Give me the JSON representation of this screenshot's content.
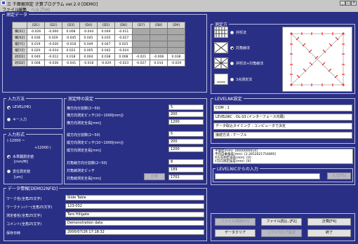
{
  "window": {
    "title": "三 千面据测定 计算ブログラム ver.2.0 [DEMO]"
  },
  "menu": [
    "ファイル",
    "编集",
    "ヘルプ(H)"
  ],
  "measure_data": {
    "title": "测定データ",
    "columns": [
      "[D1]",
      "[D2]",
      "[D3]",
      "[D4]",
      "[D5]",
      "[D6]",
      "[D7]",
      "[D8]",
      "[D9]"
    ],
    "rows": [
      {
        "label": "横[X1]",
        "values": [
          "-0.026",
          "-0.000",
          "0.008",
          "-0.044",
          "0.049",
          "-0.011",
          "",
          "",
          ""
        ]
      },
      {
        "label": "横[X2]",
        "values": [
          "0.036",
          "0.029",
          "-0.045",
          "0.045",
          "0.035",
          "-0.027",
          "",
          "",
          ""
        ]
      },
      {
        "label": "縦[Y1]",
        "values": [
          "0.019",
          "-0.030",
          "-0.018",
          "0.049",
          "0.047",
          "0.025",
          "",
          "",
          ""
        ]
      },
      {
        "label": "縦[Y2]",
        "values": [
          "0.020",
          "-0.034",
          "0.022",
          "0.005",
          "0.042",
          "-0.024",
          "",
          "",
          ""
        ]
      },
      {
        "label": "対[D1]",
        "values": [
          "0.040",
          "-0.012",
          "0.018",
          "0.004",
          "0.038",
          "0.008",
          "-0.021",
          "-0.008",
          "0.038"
        ]
      },
      {
        "label": "対[D2]",
        "values": [
          "0.008",
          "-0.036",
          "-0.041",
          "-0.018",
          "-0.029",
          "-0.023",
          "-0.027",
          "0.014",
          "-0.029"
        ]
      }
    ]
  },
  "input_method": {
    "title": "入力方法",
    "options": [
      "LEVEL(HK)",
      "キー入力"
    ]
  },
  "input_format": {
    "title": "入力形式",
    "range_low": "(-12000 ~",
    "range_high": "+12000 )",
    "options": [
      "水準器測定値",
      "変位測定値"
    ],
    "unit1": "[mm/M]",
    "unit2": "[um]"
  },
  "settings": {
    "title": "测定時の設定",
    "fields": [
      {
        "label": "横方向分割数(2~50)",
        "value": "5"
      },
      {
        "label": "横方向测定ピッチ(10~1000[mm])",
        "value": "200"
      },
      {
        "label": "横方向测定全長[mm]",
        "value": "1200"
      },
      {
        "label": "縦方向分割数(2~50)",
        "value": "5"
      },
      {
        "label": "縦方向测定ピッチ(10~1000[mm])",
        "value": "200"
      },
      {
        "label": "縦方向测定全長[mm]",
        "value": "1200"
      },
      {
        "label": "対角線方向分割数(2~50)",
        "value": "8"
      },
      {
        "label": "対角線测定ピッチ",
        "value": "189"
      },
      {
        "label": "対角線测定全長[mm]",
        "value": "1701"
      }
    ],
    "calc_button": "計算"
  },
  "pattern": {
    "title": "测定方",
    "options": [
      "井桁法",
      "対角線法",
      "井桁法+対角線法",
      "3点测定法"
    ]
  },
  "level_settings": {
    "title": "LEVELNK設定",
    "lines": [
      "COM : 1",
      "LEVELNIC : DL-S3 (インターフェース内蔵)",
      "データ取込タイミング : コンピュータで決定",
      "接続方法 : ケーブル"
    ]
  },
  "result": {
    "lines": [
      {
        "k": "平面度(mm)",
        "v": "[0000000014]"
      },
      {
        "k": "平均自乗偏差(mm)",
        "v": "[2.2652621754895]"
      },
      {
        "k": "X方向測定誤差(mm)",
        "v": "[0]"
      },
      {
        "k": "Y方向测定誤差(mm)",
        "v": "[0]"
      }
    ],
    "level_input_title": "LEVELNICからの入力",
    "input_button": "入力[F5]"
  },
  "data_info": {
    "title": "データ情報[DEMO2NFID]",
    "fields": [
      {
        "label": "ワーク名(全角25文字)",
        "value": "Slide Table"
      },
      {
        "label": "ワークナンバー(全角25文字)",
        "value": "123-032"
      },
      {
        "label": "测定者名(全角25文字)",
        "value": "Taro Hiligate"
      },
      {
        "label": "コメント(全角25文字)",
        "value": "Demonstration data"
      },
      {
        "label": "保存日時",
        "value": "2000/07/26 17:18:32"
      }
    ]
  },
  "buttons": {
    "save": "ファイル保存[F1]",
    "load": "ファイル読込..[F2]",
    "calc": "計算[F4]",
    "clear": "データクリア",
    "setting": "ソフトウエア設定",
    "exit": "終了"
  },
  "colors": {
    "background": "#2a2f86",
    "panel_border": "#b9bde6",
    "accent_marker": "#ff0000"
  }
}
